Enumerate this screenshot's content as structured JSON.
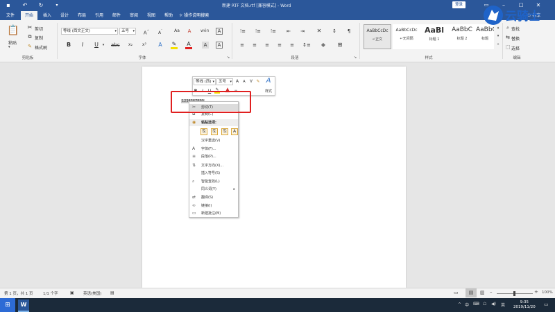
{
  "window": {
    "title": "新建 RTF 文档.rtf [兼容模式] - Word",
    "login_label": "登录",
    "share_label": "共享"
  },
  "tabs": [
    {
      "label": "文件"
    },
    {
      "label": "开始"
    },
    {
      "label": "插入"
    },
    {
      "label": "设计"
    },
    {
      "label": "布局"
    },
    {
      "label": "引用"
    },
    {
      "label": "邮件"
    },
    {
      "label": "审阅"
    },
    {
      "label": "视图"
    },
    {
      "label": "帮助"
    }
  ],
  "tell_me": "操作说明搜索",
  "ribbon": {
    "clipboard": {
      "paste_label": "粘贴",
      "cut_label": "剪切",
      "copy_label": "复制",
      "format_painter_label": "格式刷",
      "group_label": "剪贴板"
    },
    "font": {
      "font_name": "等线 (西文正文)",
      "font_size": "五号",
      "group_label": "字体"
    },
    "paragraph": {
      "group_label": "段落"
    },
    "styles": {
      "group_label": "样式",
      "items": [
        {
          "sample": "AaBbCcDc",
          "name": "↵正文"
        },
        {
          "sample": "AaBbCcDc",
          "name": "↵无间隔"
        },
        {
          "sample": "AaBl",
          "name": "标题 1"
        },
        {
          "sample": "AaBbC",
          "name": "标题 2"
        },
        {
          "sample": "AaBbC",
          "name": "标题"
        }
      ]
    },
    "editing": {
      "find_label": "查找",
      "replace_label": "替换",
      "select_label": "选择",
      "group_label": "编辑"
    }
  },
  "mini_toolbar": {
    "font_name": "等线 (西)",
    "font_size": "五号",
    "styles_label": "样式"
  },
  "selected_text": "1234567890",
  "context_menu": {
    "items": [
      {
        "label": "剪切(T)",
        "icon": "scissors-icon"
      },
      {
        "label": "复制(C)",
        "icon": "copy-icon"
      },
      {
        "label": "粘贴选项:",
        "icon": "clipboard-icon"
      },
      {
        "label": "汉字重选(V)",
        "icon": ""
      },
      {
        "label": "字体(F)...",
        "icon": "font-icon"
      },
      {
        "label": "段落(P)...",
        "icon": "paragraph-icon"
      },
      {
        "label": "文字方向(X)...",
        "icon": "text-direction-icon"
      },
      {
        "label": "插入符号(S)",
        "icon": ""
      },
      {
        "label": "智能查找(L)",
        "icon": "search-icon"
      },
      {
        "label": "同义词(Y)",
        "icon": ""
      },
      {
        "label": "翻译(S)",
        "icon": "translate-icon"
      },
      {
        "label": "链接(I)",
        "icon": "link-icon"
      },
      {
        "label": "新建批注(M)",
        "icon": "comment-icon"
      }
    ]
  },
  "status_bar": {
    "page_info": "第 1 页，共 1 页",
    "word_count": "1/1 个字",
    "language": "英语(美国)",
    "zoom": "100%"
  },
  "taskbar": {
    "time": "9:35",
    "date": "2019/11/20"
  },
  "watermark": {
    "text": "云骑士"
  },
  "colors": {
    "accent": "#2b579a",
    "highlight_box": "#e02020"
  }
}
